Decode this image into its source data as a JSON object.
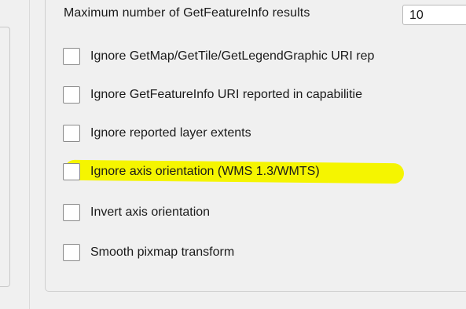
{
  "wms_settings": {
    "max_featureinfo": {
      "label": "Maximum number of GetFeatureInfo results",
      "value": "10"
    },
    "options": [
      {
        "label": "Ignore GetMap/GetTile/GetLegendGraphic URI rep",
        "checked": false,
        "highlighted": false
      },
      {
        "label": "Ignore GetFeatureInfo URI reported in capabilitie",
        "checked": false,
        "highlighted": false
      },
      {
        "label": "Ignore reported layer extents",
        "checked": false,
        "highlighted": false
      },
      {
        "label": "Ignore axis orientation (WMS 1.3/WMTS)",
        "checked": false,
        "highlighted": true
      },
      {
        "label": "Invert axis orientation",
        "checked": false,
        "highlighted": false
      },
      {
        "label": "Smooth pixmap transform",
        "checked": false,
        "highlighted": false
      }
    ]
  },
  "colors": {
    "highlight": "#f5f500",
    "background": "#f0f0f0",
    "checkbox_border": "#8a8a8a"
  }
}
